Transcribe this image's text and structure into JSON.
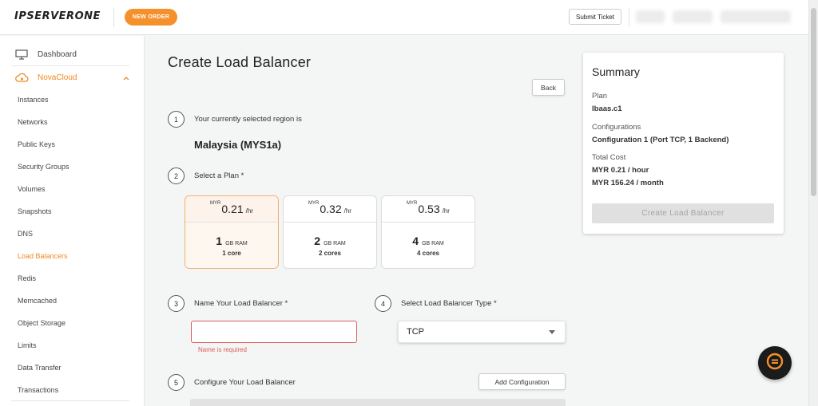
{
  "topbar": {
    "logo": "IPSERVERONE",
    "new_order": "NEW ORDER",
    "submit_ticket": "Submit Ticket"
  },
  "sidebar": {
    "dashboard": "Dashboard",
    "section": "NovaCloud",
    "items": [
      "Instances",
      "Networks",
      "Public Keys",
      "Security Groups",
      "Volumes",
      "Snapshots",
      "DNS",
      "Load Balancers",
      "Redis",
      "Memcached",
      "Object Storage",
      "Limits",
      "Data Transfer",
      "Transactions"
    ],
    "active_item": "Load Balancers"
  },
  "main": {
    "title": "Create Load Balancer",
    "back": "Back",
    "step1": {
      "num": "1",
      "label": "Your currently selected region is",
      "region": "Malaysia (MYS1a)"
    },
    "step2": {
      "num": "2",
      "label": "Select a Plan *"
    },
    "plans": [
      {
        "currency": "MYR",
        "price": "0.21",
        "unit": "/hr",
        "ram": "1",
        "ram_label": "GB RAM",
        "cores": "1 core",
        "selected": true
      },
      {
        "currency": "MYR",
        "price": "0.32",
        "unit": "/hr",
        "ram": "2",
        "ram_label": "GB RAM",
        "cores": "2 cores",
        "selected": false
      },
      {
        "currency": "MYR",
        "price": "0.53",
        "unit": "/hr",
        "ram": "4",
        "ram_label": "GB RAM",
        "cores": "4 cores",
        "selected": false
      }
    ],
    "step3": {
      "num": "3",
      "label": "Name Your Load Balancer *",
      "value": "",
      "error": "Name is required"
    },
    "step4": {
      "num": "4",
      "label": "Select Load Balancer Type *",
      "value": "TCP"
    },
    "step5": {
      "num": "5",
      "label": "Configure Your Load Balancer",
      "add": "Add Configuration"
    }
  },
  "summary": {
    "title": "Summary",
    "plan_label": "Plan",
    "plan_value": "lbaas.c1",
    "config_label": "Configurations",
    "config_value": "Configuration 1 (Port TCP, 1 Backend)",
    "cost_label": "Total Cost",
    "cost_hour": "MYR 0.21 / hour",
    "cost_month": "MYR 156.24 / month",
    "create": "Create Load Balancer"
  },
  "colors": {
    "accent": "#f5912c",
    "error": "#e05a5a"
  }
}
